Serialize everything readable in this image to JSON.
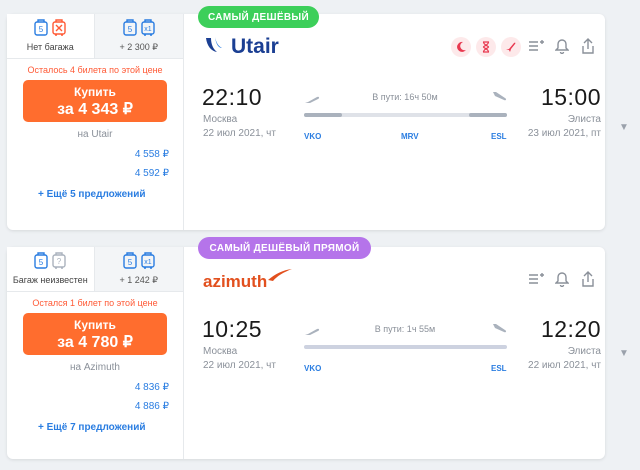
{
  "colors": {
    "accent": "#ff6d2e",
    "link": "#2a7de1",
    "cheapest_tag": "#3ccf5a",
    "direct_tag": "#b574ea"
  },
  "tickets": [
    {
      "tag": "САМЫЙ ДЕШЁВЫЙ",
      "airline_name": "Utair",
      "baggage_tabs": [
        {
          "label": "Нет багажа",
          "icons": [
            "hand-luggage-5kg-icon",
            "no-baggage-icon"
          ]
        },
        {
          "label": "+ 2 300 ₽",
          "icons": [
            "hand-luggage-5kg-icon",
            "baggage-x1-icon"
          ]
        }
      ],
      "badges": [
        "night-flight-icon",
        "long-layover-icon",
        "plane-change-icon"
      ],
      "warning": "Осталось 4 билета по этой цене",
      "buy_label": "Купить",
      "buy_price": "за 4 343 ₽",
      "seller": "на Utair",
      "alt_prices": [
        "4 558 ₽",
        "4 592 ₽"
      ],
      "more_offers": "+ Ещё 5 предложений",
      "depart": {
        "time": "22:10",
        "city": "Москва",
        "date": "22 июл 2021, чт",
        "code": "VKO"
      },
      "stop": {
        "code": "MRV"
      },
      "arrive": {
        "time": "15:00",
        "city": "Элиста",
        "date": "23 июл 2021, пт",
        "code": "ESL"
      },
      "duration": "В пути: 16ч 50м"
    },
    {
      "tag": "САМЫЙ ДЕШЁВЫЙ ПРЯМОЙ",
      "airline_name": "azimuth",
      "baggage_tabs": [
        {
          "label": "Багаж неизвестен",
          "icons": [
            "hand-luggage-5kg-icon",
            "baggage-unknown-icon"
          ]
        },
        {
          "label": "+ 1 242 ₽",
          "icons": [
            "hand-luggage-5kg-icon",
            "baggage-x1-icon"
          ]
        }
      ],
      "badges": [],
      "warning": "Остался 1 билет по этой цене",
      "buy_label": "Купить",
      "buy_price": "за 4 780 ₽",
      "seller": "на Azimuth",
      "alt_prices": [
        "4 836 ₽",
        "4 886 ₽"
      ],
      "more_offers": "+ Ещё 7 предложений",
      "depart": {
        "time": "10:25",
        "city": "Москва",
        "date": "22 июл 2021, чт",
        "code": "VKO"
      },
      "arrive": {
        "time": "12:20",
        "city": "Элиста",
        "date": "22 июл 2021, чт",
        "code": "ESL"
      },
      "duration": "В пути: 1ч 55м"
    }
  ],
  "bag_size_label": "5",
  "bag_count_label": "x1"
}
